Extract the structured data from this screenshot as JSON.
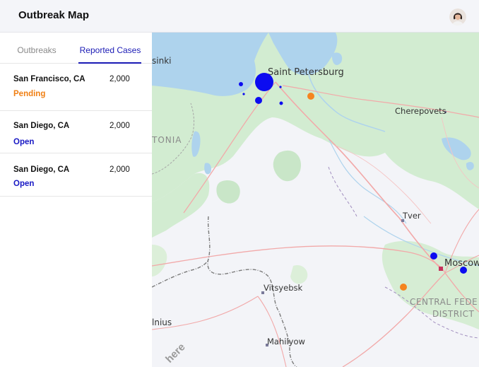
{
  "app": {
    "title": "Outbreak Map"
  },
  "tabs": [
    {
      "label": "Outbreaks"
    },
    {
      "label": "Reported Cases"
    }
  ],
  "active_tab": "Reported Cases",
  "cases": [
    {
      "location": "San Francisco, CA",
      "count": "2,000",
      "status": "Pending",
      "status_color": "#f07f13"
    },
    {
      "location": "San Diego, CA",
      "count": "2,000",
      "status": "Open",
      "status_color": "#1818c4"
    },
    {
      "location": "San Diego, CA",
      "count": "2,000",
      "status": "Open",
      "status_color": "#1818c4"
    }
  ],
  "map": {
    "labels": {
      "helsinki": "sinki",
      "saint_petersburg": "Saint Petersburg",
      "cherepovets": "Cherepovets",
      "estonia": "TONIA",
      "tver": "Tver",
      "moscow": "Moscow",
      "vitsyebsk": "Vitsyebsk",
      "vilnius": "lnius",
      "mahilyow": "Mahilyow",
      "central_federal_1": "CENTRAL FEDE",
      "central_federal_2": "DISTRICT",
      "attribution": "here"
    },
    "marker_colors": {
      "cases": "#0c0cf0",
      "outbreak": "#f5841f"
    }
  },
  "icons": {
    "avatar": "user-avatar-icon"
  }
}
